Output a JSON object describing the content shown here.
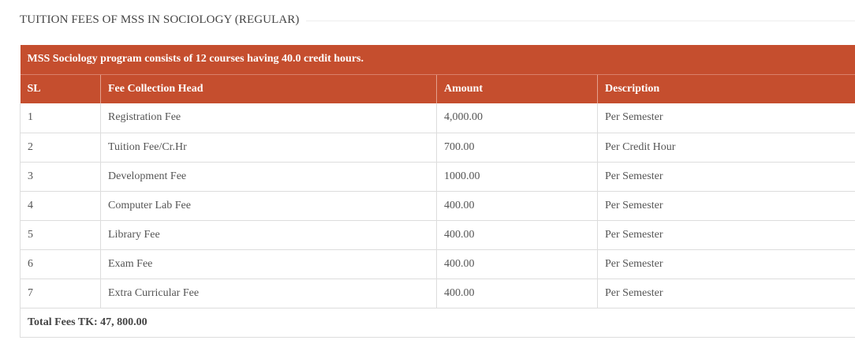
{
  "section": {
    "title": "TUITION FEES OF MSS IN SOCIOLOGY (REGULAR)"
  },
  "table": {
    "caption": "MSS Sociology program consists of 12 courses having 40.0 credit hours.",
    "headers": {
      "sl": "SL",
      "head": "Fee Collection Head",
      "amount": "Amount",
      "description": "Description"
    },
    "rows": [
      {
        "sl": "1",
        "head": "Registration Fee",
        "amount": "4,000.00",
        "description": "Per Semester"
      },
      {
        "sl": "2",
        "head": "Tuition Fee/Cr.Hr",
        "amount": "700.00",
        "description": "Per Credit Hour"
      },
      {
        "sl": "3",
        "head": "Development Fee",
        "amount": "1000.00",
        "description": "Per Semester"
      },
      {
        "sl": "4",
        "head": "Computer Lab Fee",
        "amount": "400.00",
        "description": "Per Semester"
      },
      {
        "sl": "5",
        "head": "Library Fee",
        "amount": "400.00",
        "description": "Per Semester"
      },
      {
        "sl": "6",
        "head": "Exam Fee",
        "amount": "400.00",
        "description": "Per Semester"
      },
      {
        "sl": "7",
        "head": "Extra Curricular Fee",
        "amount": "400.00",
        "description": "Per Semester"
      }
    ],
    "total": "Total Fees TK: 47, 800.00"
  },
  "colors": {
    "header_bg": "#c54e2e",
    "header_text": "#ffffff",
    "border": "#dddddd"
  }
}
